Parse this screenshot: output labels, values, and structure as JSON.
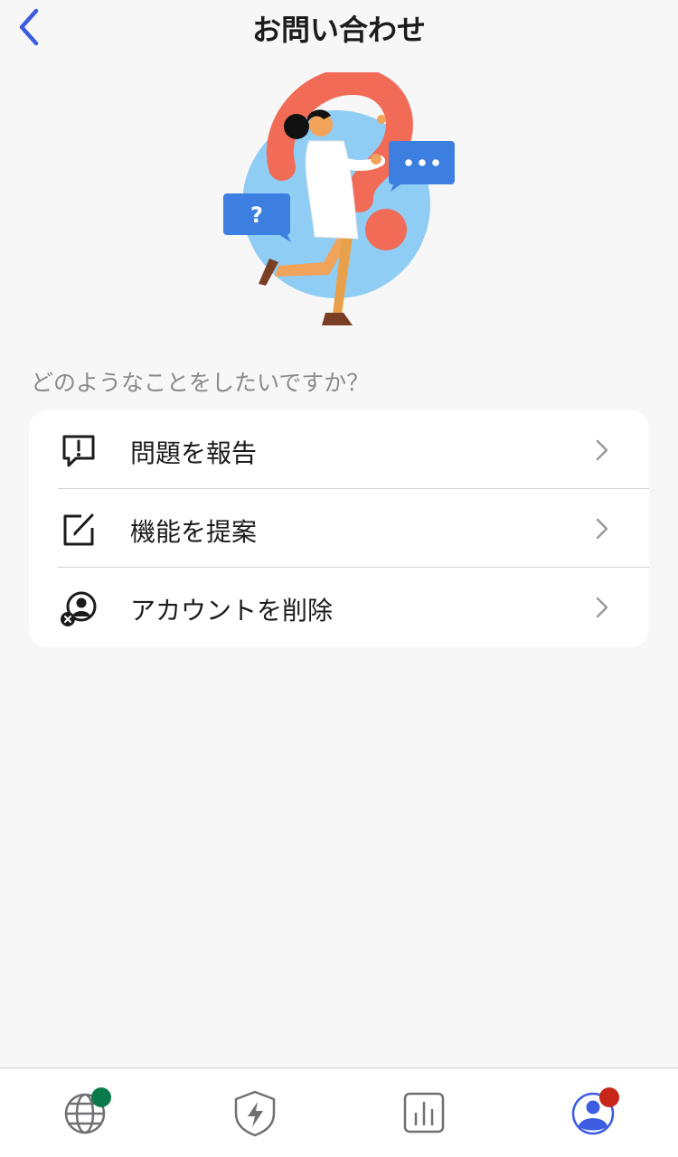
{
  "header": {
    "title": "お問い合わせ"
  },
  "prompt": "どのようなことをしたいですか？",
  "menu": {
    "items": [
      {
        "label": "問題を報告",
        "icon": "exclamation-speech-bubble-icon"
      },
      {
        "label": "機能を提案",
        "icon": "edit-square-icon"
      },
      {
        "label": "アカウントを削除",
        "icon": "remove-user-icon"
      }
    ]
  },
  "tabbar": {
    "tabs": [
      {
        "icon": "globe-icon",
        "badge_color": "#0b7a4a"
      },
      {
        "icon": "shield-bolt-icon"
      },
      {
        "icon": "bar-chart-icon"
      },
      {
        "icon": "profile-icon",
        "badge_color": "#c8251b",
        "active": true
      }
    ]
  },
  "colors": {
    "accent": "#3d5de0",
    "background": "#f7f7f7",
    "card": "#ffffff",
    "illustration_blue": "#8fcdf4",
    "illustration_coral": "#f26b57",
    "bubble_blue": "#3d7fe0"
  }
}
